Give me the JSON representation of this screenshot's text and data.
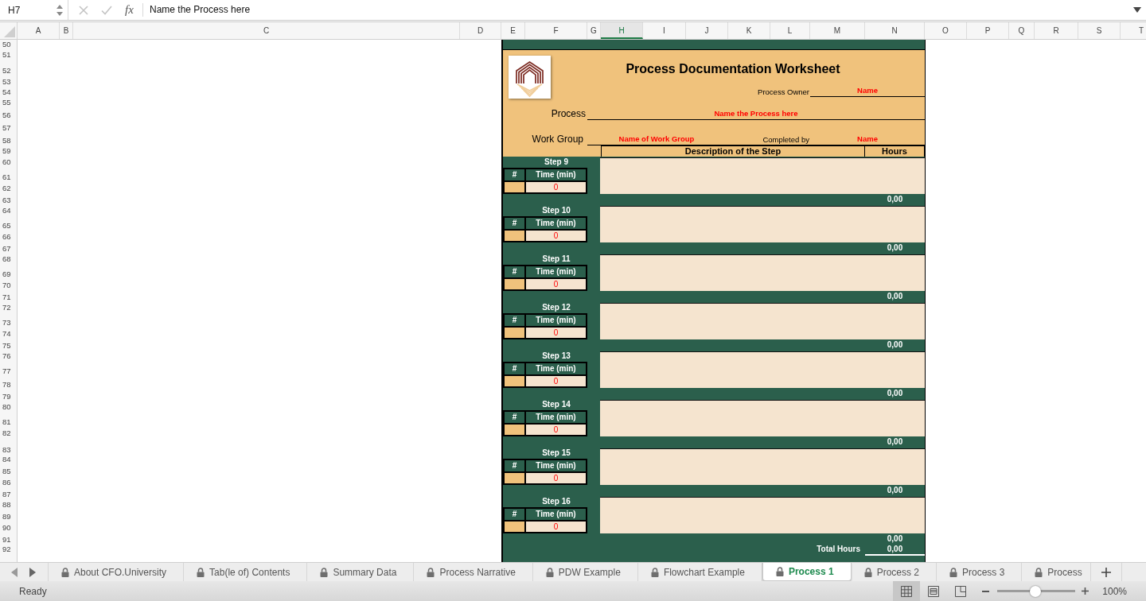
{
  "formula_bar": {
    "cell_reference": "H7",
    "function_label": "fx",
    "formula": "Name the Process here"
  },
  "columns": [
    {
      "label": "A",
      "selected": false
    },
    {
      "label": "B",
      "selected": false
    },
    {
      "label": "C",
      "selected": false
    },
    {
      "label": "D",
      "selected": false
    },
    {
      "label": "E",
      "selected": false
    },
    {
      "label": "F",
      "selected": false
    },
    {
      "label": "G",
      "selected": false
    },
    {
      "label": "H",
      "selected": true
    },
    {
      "label": "I",
      "selected": false
    },
    {
      "label": "J",
      "selected": false
    },
    {
      "label": "K",
      "selected": false
    },
    {
      "label": "L",
      "selected": false
    },
    {
      "label": "M",
      "selected": false
    },
    {
      "label": "N",
      "selected": false
    },
    {
      "label": "O",
      "selected": false
    },
    {
      "label": "P",
      "selected": false
    },
    {
      "label": "Q",
      "selected": false
    },
    {
      "label": "R",
      "selected": false
    },
    {
      "label": "S",
      "selected": false
    },
    {
      "label": "T",
      "selected": false
    }
  ],
  "rows": [
    "50",
    "51",
    "52",
    "53",
    "54",
    "55",
    "56",
    "57",
    "58",
    "59",
    "60",
    "61",
    "62",
    "63",
    "64",
    "65",
    "66",
    "67",
    "68",
    "69",
    "70",
    "71",
    "72",
    "73",
    "74",
    "75",
    "76",
    "77",
    "78",
    "79",
    "80",
    "81",
    "82",
    "83",
    "84",
    "85",
    "86",
    "87",
    "88",
    "89",
    "90",
    "91",
    "92"
  ],
  "worksheet": {
    "title": "Process Documentation Worksheet",
    "process_owner": {
      "label": "Process Owner",
      "value": "Name"
    },
    "process": {
      "label": "Process",
      "value": "Name the Process here"
    },
    "work_group": {
      "label": "Work Group",
      "value": "Name of Work Group"
    },
    "completed_by": {
      "label": "Completed by",
      "value": "Name"
    },
    "table_header": {
      "description": "Description of the Step",
      "hours": "Hours"
    },
    "steps": [
      {
        "title": "Step 9",
        "number_heading": "#",
        "time_heading": "Time (min)",
        "time": "0",
        "hours": "0,00"
      },
      {
        "title": "Step 10",
        "number_heading": "#",
        "time_heading": "Time (min)",
        "time": "0",
        "hours": "0,00"
      },
      {
        "title": "Step 11",
        "number_heading": "#",
        "time_heading": "Time (min)",
        "time": "0",
        "hours": "0,00"
      },
      {
        "title": "Step 12",
        "number_heading": "#",
        "time_heading": "Time (min)",
        "time": "0",
        "hours": "0,00"
      },
      {
        "title": "Step 13",
        "number_heading": "#",
        "time_heading": "Time (min)",
        "time": "0",
        "hours": "0,00"
      },
      {
        "title": "Step 14",
        "number_heading": "#",
        "time_heading": "Time (min)",
        "time": "0",
        "hours": "0,00"
      },
      {
        "title": "Step 15",
        "number_heading": "#",
        "time_heading": "Time (min)",
        "time": "0",
        "hours": "0,00"
      },
      {
        "title": "Step 16",
        "number_heading": "#",
        "time_heading": "Time (min)",
        "time": "0",
        "hours": "0,00"
      }
    ],
    "total": {
      "label": "Total Hours",
      "value": "0,00"
    }
  },
  "sheet_tabs": [
    {
      "label": "About CFO.University",
      "locked": true,
      "selected": false
    },
    {
      "label": "Tab(le of) Contents",
      "locked": true,
      "selected": false
    },
    {
      "label": "Summary Data",
      "locked": true,
      "selected": false
    },
    {
      "label": "Process Narrative",
      "locked": true,
      "selected": false
    },
    {
      "label": "PDW Example",
      "locked": true,
      "selected": false
    },
    {
      "label": "Flowchart Example",
      "locked": true,
      "selected": false
    },
    {
      "label": "Process 1",
      "locked": true,
      "selected": true
    },
    {
      "label": "Process 2",
      "locked": true,
      "selected": false
    },
    {
      "label": "Process 3",
      "locked": true,
      "selected": false
    },
    {
      "label": "Process",
      "locked": true,
      "selected": false
    }
  ],
  "status_bar": {
    "status": "Ready",
    "views": [
      {
        "kind": "normal",
        "selected": true
      },
      {
        "kind": "page_layout",
        "selected": false
      },
      {
        "kind": "page_break",
        "selected": false
      }
    ],
    "zoom": {
      "level": 0.49,
      "reading": "100%"
    }
  }
}
